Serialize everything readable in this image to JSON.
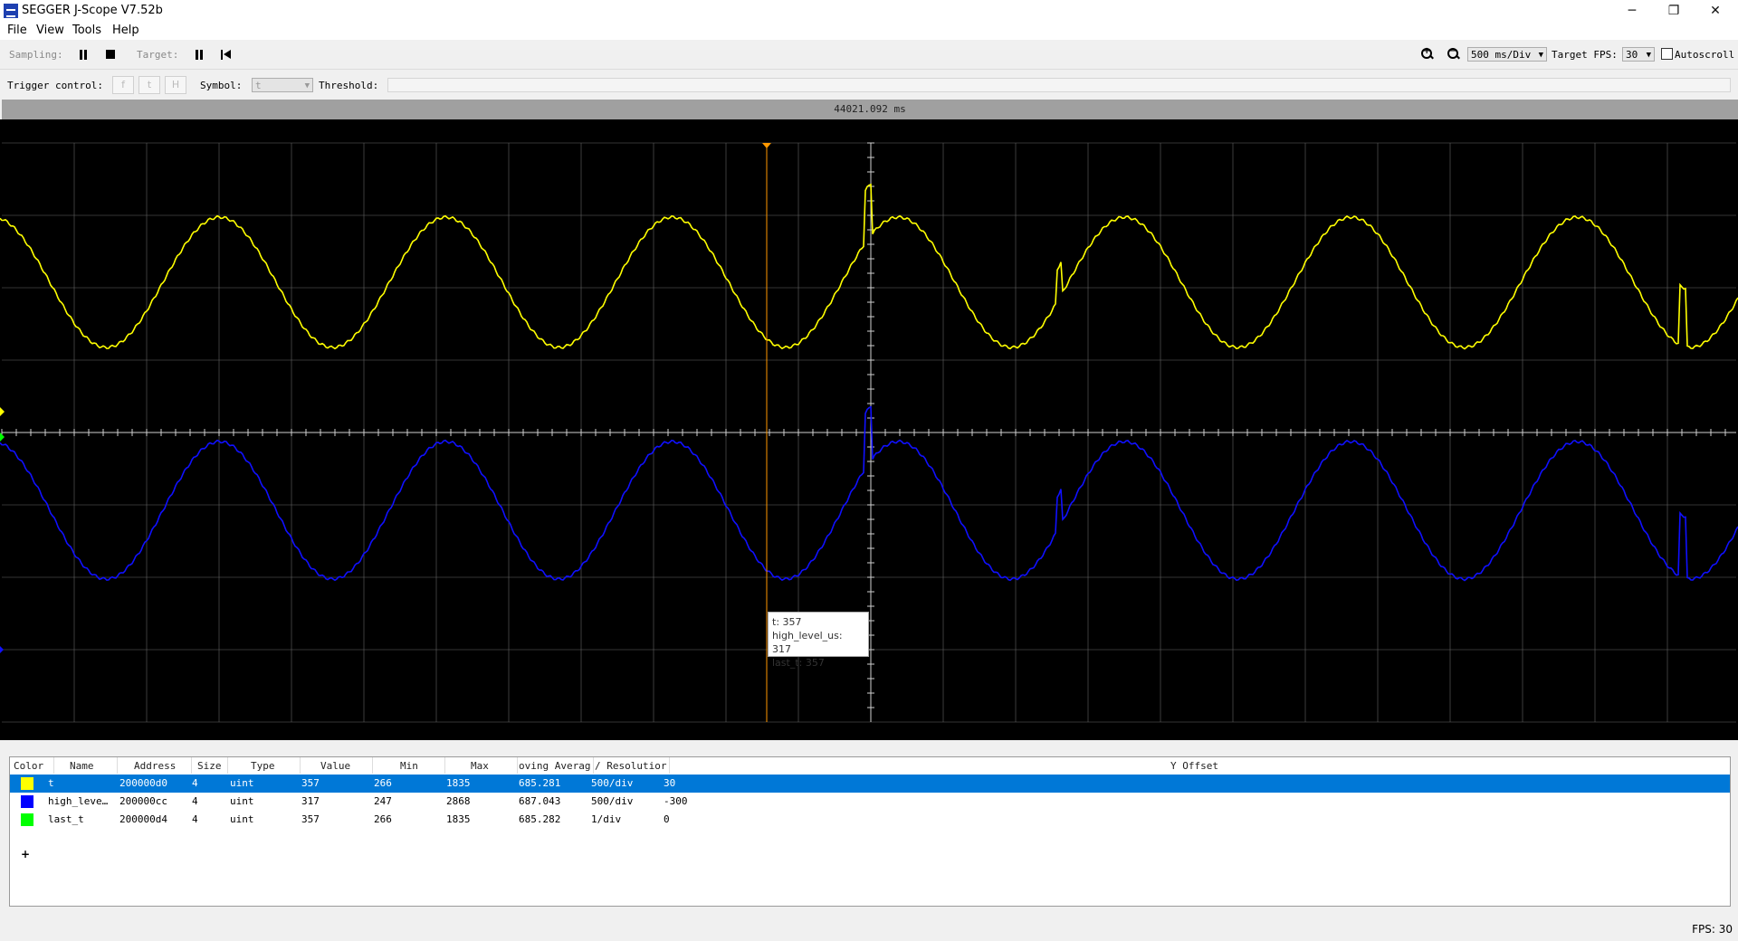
{
  "window": {
    "title": "SEGGER J-Scope V7.52b",
    "minimize": "─",
    "maximize": "❐",
    "close": "✕"
  },
  "menu": [
    "File",
    "View",
    "Tools",
    "Help"
  ],
  "toolbar": {
    "sampling_label": "Sampling:",
    "target_label": "Target:",
    "zoom_in_icon": "zoom-in-icon",
    "zoom_out_icon": "zoom-out-icon",
    "time_div": "500 ms/Div",
    "target_fps_label": "Target FPS:",
    "target_fps": "30",
    "autoscroll_label": "Autoscroll",
    "autoscroll_checked": false
  },
  "trigger": {
    "label": "Trigger control:",
    "buttons": [
      "f",
      "t",
      "H"
    ],
    "symbol_label": "Symbol:",
    "symbol_value": "t",
    "threshold_label": "Threshold:"
  },
  "scope": {
    "time_readout": "44021.092 ms",
    "grid_color": "#666666",
    "cursor_color": "#ff9900",
    "tooltip": [
      "t: 357",
      "high_level_us: 317",
      "last_t: 357"
    ]
  },
  "table": {
    "headers": [
      "Color",
      "Name",
      "Address",
      "Size",
      "Type",
      "Value",
      "Min",
      "Max",
      "oving Averag",
      "/ Resolutior",
      "Y Offset"
    ],
    "rows": [
      {
        "color": "#ffff00",
        "name": "t",
        "address": "200000d0",
        "size": "4",
        "type": "uint",
        "value": "357",
        "min": "266",
        "max": "1835",
        "avg": "685.281",
        "res": "500/div",
        "yoffset": "30",
        "selected": true
      },
      {
        "color": "#0000ff",
        "name": "high_leve…",
        "address": "200000cc",
        "size": "4",
        "type": "uint",
        "value": "317",
        "min": "247",
        "max": "2868",
        "avg": "687.043",
        "res": "500/div",
        "yoffset": "-300",
        "selected": false
      },
      {
        "color": "#00ff00",
        "name": "last_t",
        "address": "200000d4",
        "size": "4",
        "type": "uint",
        "value": "357",
        "min": "266",
        "max": "1835",
        "avg": "685.282",
        "res": "1/div",
        "yoffset": "0",
        "selected": false
      }
    ],
    "add_label": "+"
  },
  "status": {
    "fps": "FPS: 30"
  }
}
